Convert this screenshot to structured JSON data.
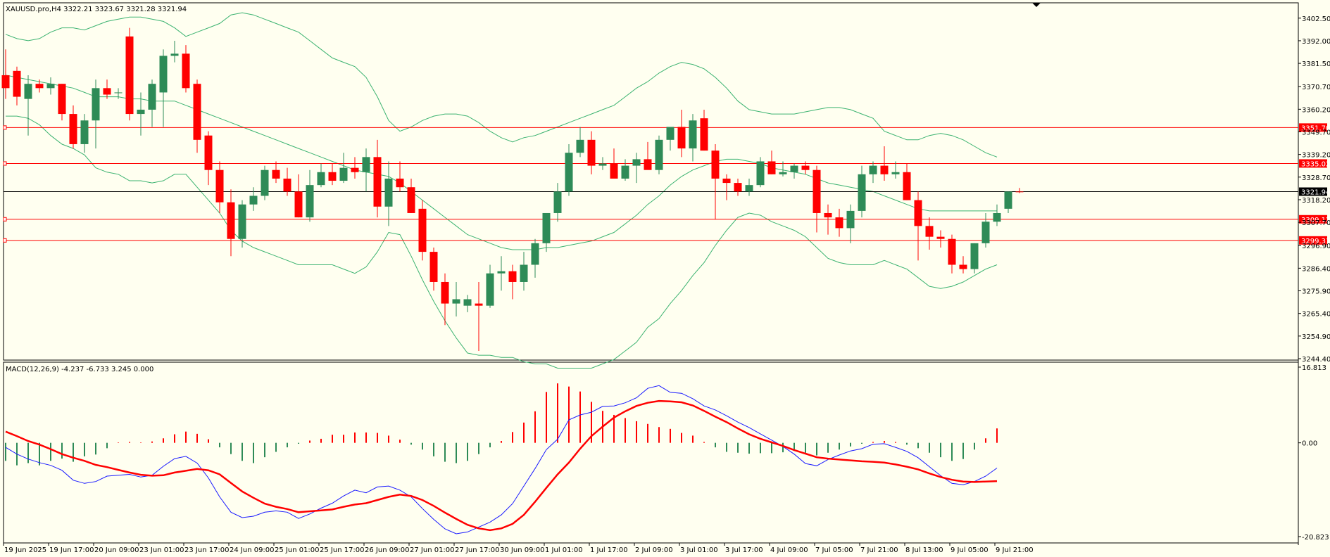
{
  "header": {
    "symbol_line": "XAUUSD.pro,H4  3322.21 3323.67 3321.28 3321.94",
    "macd_line": "MACD(12,26,9) -4.237 -6.733 3.245 0.000"
  },
  "colors": {
    "background": "#fffff0",
    "bull": "#2e8b57",
    "bear": "#ff0000",
    "band": "#3cb371",
    "hline": "#ff0000",
    "price_line": "#000000",
    "macd_main": "#1a1aff",
    "macd_signal": "#ff0000"
  },
  "chart_data": [
    {
      "type": "candlestick",
      "title": "XAUUSD.pro,H4",
      "ylim": [
        3244.4,
        3407.0
      ],
      "price_ticks": [
        "3402.50",
        "3392.00",
        "3381.50",
        "3370.70",
        "3360.20",
        "3349.70",
        "3339.20",
        "3328.70",
        "3318.20",
        "3307.70",
        "3296.90",
        "3286.40",
        "3275.90",
        "3265.40",
        "3254.90",
        "3244.40"
      ],
      "time_labels": [
        {
          "i": 0,
          "t": "19 Jun 2025"
        },
        {
          "i": 4,
          "t": "19 Jun 17:00"
        },
        {
          "i": 8,
          "t": "20 Jun 09:00"
        },
        {
          "i": 12,
          "t": "23 Jun 01:00"
        },
        {
          "i": 16,
          "t": "23 Jun 17:00"
        },
        {
          "i": 20,
          "t": "24 Jun 09:00"
        },
        {
          "i": 24,
          "t": "25 Jun 01:00"
        },
        {
          "i": 28,
          "t": "25 Jun 17:00"
        },
        {
          "i": 32,
          "t": "26 Jun 09:00"
        },
        {
          "i": 36,
          "t": "27 Jun 01:00"
        },
        {
          "i": 40,
          "t": "27 Jun 17:00"
        },
        {
          "i": 44,
          "t": "30 Jun 09:00"
        },
        {
          "i": 48,
          "t": "1 Jul 01:00"
        },
        {
          "i": 52,
          "t": "1 Jul 17:00"
        },
        {
          "i": 56,
          "t": "2 Jul 09:00"
        },
        {
          "i": 60,
          "t": "3 Jul 01:00"
        },
        {
          "i": 64,
          "t": "3 Jul 17:00"
        },
        {
          "i": 68,
          "t": "4 Jul 09:00"
        },
        {
          "i": 72,
          "t": "7 Jul 05:00"
        },
        {
          "i": 76,
          "t": "7 Jul 21:00"
        },
        {
          "i": 80,
          "t": "8 Jul 13:00"
        },
        {
          "i": 84,
          "t": "9 Jul 05:00"
        },
        {
          "i": 88,
          "t": "9 Jul 21:00"
        }
      ],
      "ohlc": [
        [
          3376,
          3388,
          3365,
          3370
        ],
        [
          3378,
          3380,
          3362,
          3366
        ],
        [
          3365,
          3376,
          3348,
          3372
        ],
        [
          3372,
          3374,
          3368,
          3370
        ],
        [
          3370,
          3375,
          3367,
          3372
        ],
        [
          3372,
          3372,
          3355,
          3358
        ],
        [
          3358,
          3362,
          3342,
          3344
        ],
        [
          3344,
          3358,
          3340,
          3355
        ],
        [
          3355,
          3374,
          3342,
          3370
        ],
        [
          3370,
          3374,
          3365,
          3367
        ],
        [
          3368,
          3370,
          3365,
          3368
        ],
        [
          3394,
          3398,
          3355,
          3358
        ],
        [
          3358,
          3368,
          3348,
          3360
        ],
        [
          3360,
          3374,
          3352,
          3372
        ],
        [
          3368,
          3388,
          3352,
          3385
        ],
        [
          3385,
          3392,
          3382,
          3386
        ],
        [
          3386,
          3390,
          3368,
          3370
        ],
        [
          3372,
          3374,
          3340,
          3346
        ],
        [
          3348,
          3350,
          3325,
          3332
        ],
        [
          3332,
          3336,
          3312,
          3317
        ],
        [
          3317,
          3323,
          3292,
          3300
        ],
        [
          3300,
          3318,
          3296,
          3316
        ],
        [
          3316,
          3324,
          3313,
          3320
        ],
        [
          3320,
          3334,
          3318,
          3332
        ],
        [
          3332,
          3336,
          3326,
          3328
        ],
        [
          3328,
          3333,
          3320,
          3322
        ],
        [
          3322,
          3330,
          3310,
          3310
        ],
        [
          3310,
          3332,
          3308,
          3325
        ],
        [
          3325,
          3335,
          3324,
          3331
        ],
        [
          3331,
          3335,
          3325,
          3327
        ],
        [
          3327,
          3340,
          3326,
          3333
        ],
        [
          3333,
          3338,
          3328,
          3331
        ],
        [
          3331,
          3342,
          3322,
          3338
        ],
        [
          3338,
          3346,
          3310,
          3315
        ],
        [
          3315,
          3336,
          3306,
          3328
        ],
        [
          3328,
          3336,
          3322,
          3324
        ],
        [
          3324,
          3328,
          3312,
          3312
        ],
        [
          3314,
          3318,
          3290,
          3294
        ],
        [
          3294,
          3296,
          3276,
          3280
        ],
        [
          3280,
          3284,
          3260,
          3270
        ],
        [
          3270,
          3280,
          3264,
          3272
        ],
        [
          3269,
          3274,
          3266,
          3272
        ],
        [
          3270,
          3280,
          3248,
          3269
        ],
        [
          3269,
          3288,
          3268,
          3284
        ],
        [
          3284,
          3292,
          3276,
          3285
        ],
        [
          3285,
          3288,
          3272,
          3280
        ],
        [
          3280,
          3294,
          3276,
          3288
        ],
        [
          3288,
          3300,
          3282,
          3298
        ],
        [
          3298,
          3312,
          3294,
          3312
        ],
        [
          3312,
          3326,
          3308,
          3322
        ],
        [
          3322,
          3344,
          3320,
          3340
        ],
        [
          3340,
          3352,
          3338,
          3346
        ],
        [
          3346,
          3350,
          3330,
          3334
        ],
        [
          3334,
          3338,
          3332,
          3335
        ],
        [
          3335,
          3342,
          3329,
          3328
        ],
        [
          3328,
          3337,
          3327,
          3334
        ],
        [
          3334,
          3340,
          3326,
          3337
        ],
        [
          3337,
          3345,
          3334,
          3332
        ],
        [
          3332,
          3348,
          3330,
          3346
        ],
        [
          3346,
          3350,
          3341,
          3352
        ],
        [
          3352,
          3360,
          3338,
          3342
        ],
        [
          3342,
          3358,
          3336,
          3355
        ],
        [
          3356,
          3360,
          3341,
          3341
        ],
        [
          3341,
          3344,
          3309,
          3328
        ],
        [
          3328,
          3330,
          3318,
          3326
        ],
        [
          3326,
          3328,
          3320,
          3322
        ],
        [
          3322,
          3328,
          3320,
          3325
        ],
        [
          3325,
          3338,
          3324,
          3336
        ],
        [
          3336,
          3341,
          3330,
          3330
        ],
        [
          3330,
          3336,
          3329,
          3331
        ],
        [
          3331,
          3335,
          3328,
          3334
        ],
        [
          3334,
          3336,
          3330,
          3332
        ],
        [
          3332,
          3334,
          3303,
          3312
        ],
        [
          3312,
          3316,
          3302,
          3310
        ],
        [
          3310,
          3314,
          3301,
          3305
        ],
        [
          3305,
          3316,
          3298,
          3313
        ],
        [
          3313,
          3334,
          3310,
          3330
        ],
        [
          3330,
          3336,
          3326,
          3334
        ],
        [
          3334,
          3343,
          3327,
          3330
        ],
        [
          3330,
          3336,
          3328,
          3331
        ],
        [
          3331,
          3335,
          3318,
          3318
        ],
        [
          3318,
          3322,
          3290,
          3306
        ],
        [
          3306,
          3310,
          3295,
          3301
        ],
        [
          3301,
          3304,
          3296,
          3300
        ],
        [
          3300,
          3302,
          3284,
          3288
        ],
        [
          3288,
          3292,
          3284,
          3286
        ],
        [
          3286,
          3298,
          3284,
          3298
        ],
        [
          3298,
          3312,
          3296,
          3308
        ],
        [
          3308,
          3316,
          3306,
          3312
        ],
        [
          3314,
          3322,
          3312,
          3322
        ],
        [
          3322,
          3323.67,
          3321.28,
          3321.94
        ]
      ],
      "bollinger": {
        "upper": [
          3395,
          3393,
          3392,
          3393,
          3396,
          3398,
          3398,
          3397,
          3399,
          3401,
          3402,
          3403,
          3403,
          3402,
          3401,
          3398,
          3394,
          3396,
          3398,
          3400,
          3404,
          3405,
          3404,
          3402,
          3400,
          3398,
          3396,
          3392,
          3388,
          3384,
          3382,
          3380,
          3375,
          3366,
          3355,
          3350,
          3352,
          3355,
          3357,
          3358,
          3358,
          3357,
          3354,
          3350,
          3347,
          3345,
          3347,
          3348,
          3350,
          3352,
          3354,
          3356,
          3358,
          3360,
          3362,
          3366,
          3370,
          3373,
          3377,
          3380,
          3382,
          3381,
          3379,
          3375,
          3370,
          3364,
          3360,
          3359,
          3358,
          3358,
          3358,
          3359,
          3360,
          3361,
          3361,
          3360,
          3358,
          3356,
          3350,
          3348,
          3346,
          3346,
          3348,
          3349,
          3348,
          3346,
          3343,
          3340,
          3338
        ],
        "middle": [
          3376,
          3375,
          3374,
          3373,
          3372,
          3371,
          3370,
          3368,
          3366,
          3366,
          3366,
          3365,
          3365,
          3364,
          3364,
          3364,
          3362,
          3360,
          3358,
          3356,
          3354,
          3352,
          3350,
          3348,
          3346,
          3344,
          3342,
          3340,
          3338,
          3336,
          3334,
          3332,
          3331,
          3330,
          3329,
          3326,
          3322,
          3318,
          3314,
          3310,
          3306,
          3302,
          3300,
          3298,
          3296,
          3295,
          3295,
          3295,
          3296,
          3296,
          3297,
          3298,
          3299,
          3301,
          3303,
          3307,
          3311,
          3316,
          3320,
          3325,
          3329,
          3332,
          3334,
          3336,
          3337,
          3337,
          3336,
          3335,
          3333,
          3332,
          3331,
          3330,
          3328,
          3326,
          3325,
          3324,
          3323,
          3322,
          3320,
          3318,
          3316,
          3314,
          3313,
          3313,
          3313,
          3313,
          3313,
          3313,
          3313
        ],
        "lower": [
          3357,
          3357,
          3356,
          3353,
          3348,
          3344,
          3342,
          3339,
          3333,
          3331,
          3330,
          3327,
          3327,
          3326,
          3327,
          3330,
          3330,
          3324,
          3318,
          3312,
          3304,
          3299,
          3296,
          3294,
          3292,
          3290,
          3288,
          3288,
          3288,
          3288,
          3286,
          3284,
          3287,
          3294,
          3303,
          3302,
          3292,
          3281,
          3271,
          3262,
          3254,
          3247,
          3246,
          3246,
          3245,
          3245,
          3243,
          3242,
          3242,
          3240,
          3240,
          3240,
          3240,
          3242,
          3244,
          3248,
          3252,
          3259,
          3263,
          3270,
          3276,
          3283,
          3289,
          3297,
          3304,
          3310,
          3312,
          3311,
          3308,
          3306,
          3304,
          3301,
          3296,
          3291,
          3289,
          3288,
          3288,
          3288,
          3290,
          3288,
          3286,
          3282,
          3278,
          3277,
          3278,
          3280,
          3283,
          3286,
          3288
        ]
      },
      "horizontal_lines": [
        {
          "price": 3351.7,
          "label": "3351.70",
          "color": "#ff0000"
        },
        {
          "price": 3335.02,
          "label": "3335.02",
          "color": "#ff0000"
        },
        {
          "price": 3309.12,
          "label": "3309.12",
          "color": "#ff0000"
        },
        {
          "price": 3299.31,
          "label": "3299.31",
          "color": "#ff0000"
        },
        {
          "price": 3321.94,
          "label": "3321.94",
          "color": "#000000"
        }
      ]
    },
    {
      "type": "bar",
      "title": "MACD(12,26,9)",
      "ylim": [
        -20.823,
        16.813
      ],
      "y_ticks": [
        "16.813",
        "0.00",
        "-20.823"
      ],
      "histogram": [
        -4.0,
        -5.0,
        -4.5,
        -5.0,
        -4.0,
        -3.5,
        -4.2,
        -3.0,
        -2.6,
        -1.2,
        0.1,
        0.2,
        0.1,
        0.3,
        1.0,
        1.9,
        2.5,
        2.0,
        0.8,
        -1.0,
        -2.5,
        -4.0,
        -4.5,
        -3.2,
        -2.0,
        -1.0,
        -0.2,
        0.5,
        0.9,
        1.8,
        1.8,
        2.3,
        2.3,
        2.2,
        1.6,
        0.7,
        -0.4,
        -1.5,
        -3.0,
        -4.2,
        -4.5,
        -4.0,
        -2.5,
        -1.0,
        0.4,
        2.4,
        4.5,
        7.0,
        11.3,
        13.2,
        12.5,
        11.4,
        9.1,
        7.1,
        6.2,
        5.5,
        4.8,
        4.2,
        3.5,
        3.1,
        2.2,
        1.6,
        0.2,
        -1.0,
        -2.0,
        -2.2,
        -2.4,
        -2.3,
        -2.3,
        -2.1,
        -1.8,
        -2.2,
        -2.8,
        -2.2,
        -1.5,
        -0.8,
        -0.2,
        0.2,
        0.4,
        0.2,
        -0.4,
        -1.2,
        -2.2,
        -3.2,
        -4.0,
        -3.6,
        -1.5,
        1.0,
        3.2
      ],
      "main": [
        -1.0,
        -2.5,
        -3.6,
        -4.4,
        -5.0,
        -6.1,
        -8.3,
        -9.0,
        -8.6,
        -7.4,
        -7.2,
        -7.0,
        -7.6,
        -7.2,
        -5.2,
        -3.5,
        -3.0,
        -4.5,
        -7.8,
        -12.0,
        -15.4,
        -16.6,
        -16.3,
        -15.4,
        -15.1,
        -15.4,
        -16.8,
        -15.8,
        -14.5,
        -13.4,
        -11.8,
        -10.5,
        -11.1,
        -9.8,
        -9.6,
        -10.5,
        -12.0,
        -14.6,
        -17.0,
        -19.1,
        -20.2,
        -19.8,
        -18.7,
        -17.6,
        -16.0,
        -13.5,
        -9.6,
        -5.7,
        -1.5,
        0.8,
        5.1,
        6.2,
        6.8,
        8.1,
        8.2,
        8.9,
        10.0,
        12.1,
        12.7,
        11.2,
        11.0,
        9.8,
        8.2,
        7.3,
        6.0,
        4.6,
        3.4,
        2.0,
        0.6,
        -0.8,
        -2.5,
        -4.6,
        -5.1,
        -3.7,
        -2.7,
        -1.8,
        -1.3,
        -0.3,
        -0.2,
        -1.0,
        -1.9,
        -3.3,
        -5.3,
        -7.3,
        -9.0,
        -9.3,
        -8.6,
        -7.4,
        -5.6
      ],
      "signal": [
        2.5,
        1.5,
        0.4,
        -0.4,
        -1.4,
        -2.5,
        -3.3,
        -4.0,
        -4.9,
        -5.4,
        -6.0,
        -6.6,
        -7.1,
        -7.3,
        -7.2,
        -6.6,
        -6.2,
        -5.8,
        -6.1,
        -7.0,
        -8.9,
        -10.8,
        -12.2,
        -13.5,
        -14.2,
        -14.7,
        -15.4,
        -15.2,
        -15.0,
        -14.8,
        -14.2,
        -13.7,
        -13.4,
        -12.7,
        -12.0,
        -11.5,
        -11.8,
        -12.7,
        -14.0,
        -15.5,
        -16.9,
        -18.2,
        -19.0,
        -19.4,
        -19.0,
        -18.0,
        -16.0,
        -13.1,
        -10.0,
        -7.0,
        -4.4,
        -1.3,
        1.5,
        3.6,
        5.6,
        7.0,
        8.2,
        8.9,
        9.3,
        9.2,
        9.0,
        8.3,
        7.1,
        5.8,
        4.6,
        3.2,
        1.9,
        0.9,
        0.1,
        -0.7,
        -1.6,
        -2.4,
        -3.2,
        -3.5,
        -3.7,
        -3.9,
        -4.1,
        -4.2,
        -4.4,
        -4.8,
        -5.3,
        -5.9,
        -6.8,
        -7.6,
        -8.2,
        -8.6,
        -8.7,
        -8.6,
        -8.5
      ]
    }
  ]
}
